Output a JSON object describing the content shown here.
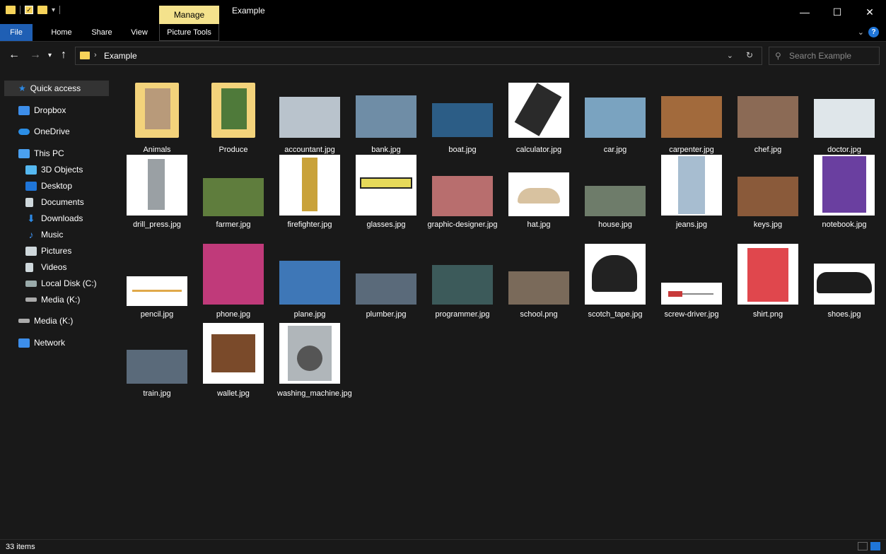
{
  "window": {
    "title": "Example",
    "context_tab": "Manage",
    "controls": {
      "minimize": "—",
      "maximize": "☐",
      "close": "✕"
    }
  },
  "ribbon": {
    "tabs": [
      {
        "label": "File"
      },
      {
        "label": "Home"
      },
      {
        "label": "Share"
      },
      {
        "label": "View"
      },
      {
        "label": "Picture Tools"
      }
    ]
  },
  "address": {
    "path": "Example",
    "search_placeholder": "Search Example"
  },
  "nav": {
    "items": [
      {
        "label": "Quick access",
        "icon": "star-icon",
        "color": "#2d8ae5"
      },
      {
        "label": "Dropbox",
        "icon": "dropbox-icon",
        "color": "#3d8eea"
      },
      {
        "label": "OneDrive",
        "icon": "cloud-icon",
        "color": "#2b8ee6"
      },
      {
        "label": "This PC",
        "icon": "computer-icon",
        "color": "#4aa0f0"
      },
      {
        "label": "3D Objects",
        "icon": "cube-icon",
        "color": "#55b8f0"
      },
      {
        "label": "Desktop",
        "icon": "desktop-icon",
        "color": "#1f75d8"
      },
      {
        "label": "Documents",
        "icon": "document-icon",
        "color": "#cfd8dc"
      },
      {
        "label": "Downloads",
        "icon": "download-icon",
        "color": "#2d8ae5"
      },
      {
        "label": "Music",
        "icon": "music-icon",
        "color": "#3d8eea"
      },
      {
        "label": "Pictures",
        "icon": "pictures-icon",
        "color": "#cfd8dc"
      },
      {
        "label": "Videos",
        "icon": "video-icon",
        "color": "#cfd8dc"
      },
      {
        "label": "Local Disk (C:)",
        "icon": "drive-icon",
        "color": "#9aa"
      },
      {
        "label": "Media (K:)",
        "icon": "drive-icon",
        "color": "#aaa"
      },
      {
        "label": "Media (K:)",
        "icon": "drive-icon",
        "color": "#aaa"
      },
      {
        "label": "Network",
        "icon": "network-icon",
        "color": "#3d8eea"
      }
    ]
  },
  "files": [
    {
      "name": "Animals",
      "kind": "folder",
      "color": "#f3d37b"
    },
    {
      "name": "Produce",
      "kind": "folder",
      "color": "#f3d37b"
    },
    {
      "name": "accountant.jpg",
      "kind": "image",
      "color": "#b9c3cc"
    },
    {
      "name": "bank.jpg",
      "kind": "image",
      "color": "#6f8da6"
    },
    {
      "name": "boat.jpg",
      "kind": "image",
      "color": "#2c5d86"
    },
    {
      "name": "calculator.jpg",
      "kind": "image",
      "color": "#2a2a2a"
    },
    {
      "name": "car.jpg",
      "kind": "image",
      "color": "#7aa3c0"
    },
    {
      "name": "carpenter.jpg",
      "kind": "image",
      "color": "#a26a3c"
    },
    {
      "name": "chef.jpg",
      "kind": "image",
      "color": "#8b6a55"
    },
    {
      "name": "doctor.jpg",
      "kind": "image",
      "color": "#dfe6ea"
    },
    {
      "name": "drill_press.jpg",
      "kind": "image",
      "color": "#9aa0a4"
    },
    {
      "name": "farmer.jpg",
      "kind": "image",
      "color": "#5f7d3d"
    },
    {
      "name": "firefighter.jpg",
      "kind": "image",
      "color": "#c9a23a"
    },
    {
      "name": "glasses.jpg",
      "kind": "image",
      "color": "#e6d95a"
    },
    {
      "name": "graphic-designer.jpg",
      "kind": "image",
      "color": "#b86e6e"
    },
    {
      "name": "hat.jpg",
      "kind": "image",
      "color": "#d8c2a0"
    },
    {
      "name": "house.jpg",
      "kind": "image",
      "color": "#6e7c6a"
    },
    {
      "name": "jeans.jpg",
      "kind": "image",
      "color": "#a7bdd0"
    },
    {
      "name": "keys.jpg",
      "kind": "image",
      "color": "#8a5a3a"
    },
    {
      "name": "notebook.jpg",
      "kind": "image",
      "color": "#6a3fa0"
    },
    {
      "name": "pencil.jpg",
      "kind": "image",
      "color": "#e0a94a"
    },
    {
      "name": "phone.jpg",
      "kind": "image",
      "color": "#c03a7a"
    },
    {
      "name": "plane.jpg",
      "kind": "image",
      "color": "#3e77b7"
    },
    {
      "name": "plumber.jpg",
      "kind": "image",
      "color": "#5a6a7a"
    },
    {
      "name": "programmer.jpg",
      "kind": "image",
      "color": "#3c5a5a"
    },
    {
      "name": "school.png",
      "kind": "image",
      "color": "#7a6a5a"
    },
    {
      "name": "scotch_tape.jpg",
      "kind": "image",
      "color": "#222222"
    },
    {
      "name": "screw-driver.jpg",
      "kind": "image",
      "color": "#c83a3a"
    },
    {
      "name": "shirt.png",
      "kind": "image",
      "color": "#e0474d"
    },
    {
      "name": "shoes.jpg",
      "kind": "image",
      "color": "#1c1c1c"
    },
    {
      "name": "train.jpg",
      "kind": "image",
      "color": "#5a6a7a"
    },
    {
      "name": "wallet.jpg",
      "kind": "image",
      "color": "#7a4a2a"
    },
    {
      "name": "washing_machine.jpg",
      "kind": "image",
      "color": "#b0b6ba"
    }
  ],
  "status": {
    "items_text": "33 items"
  }
}
